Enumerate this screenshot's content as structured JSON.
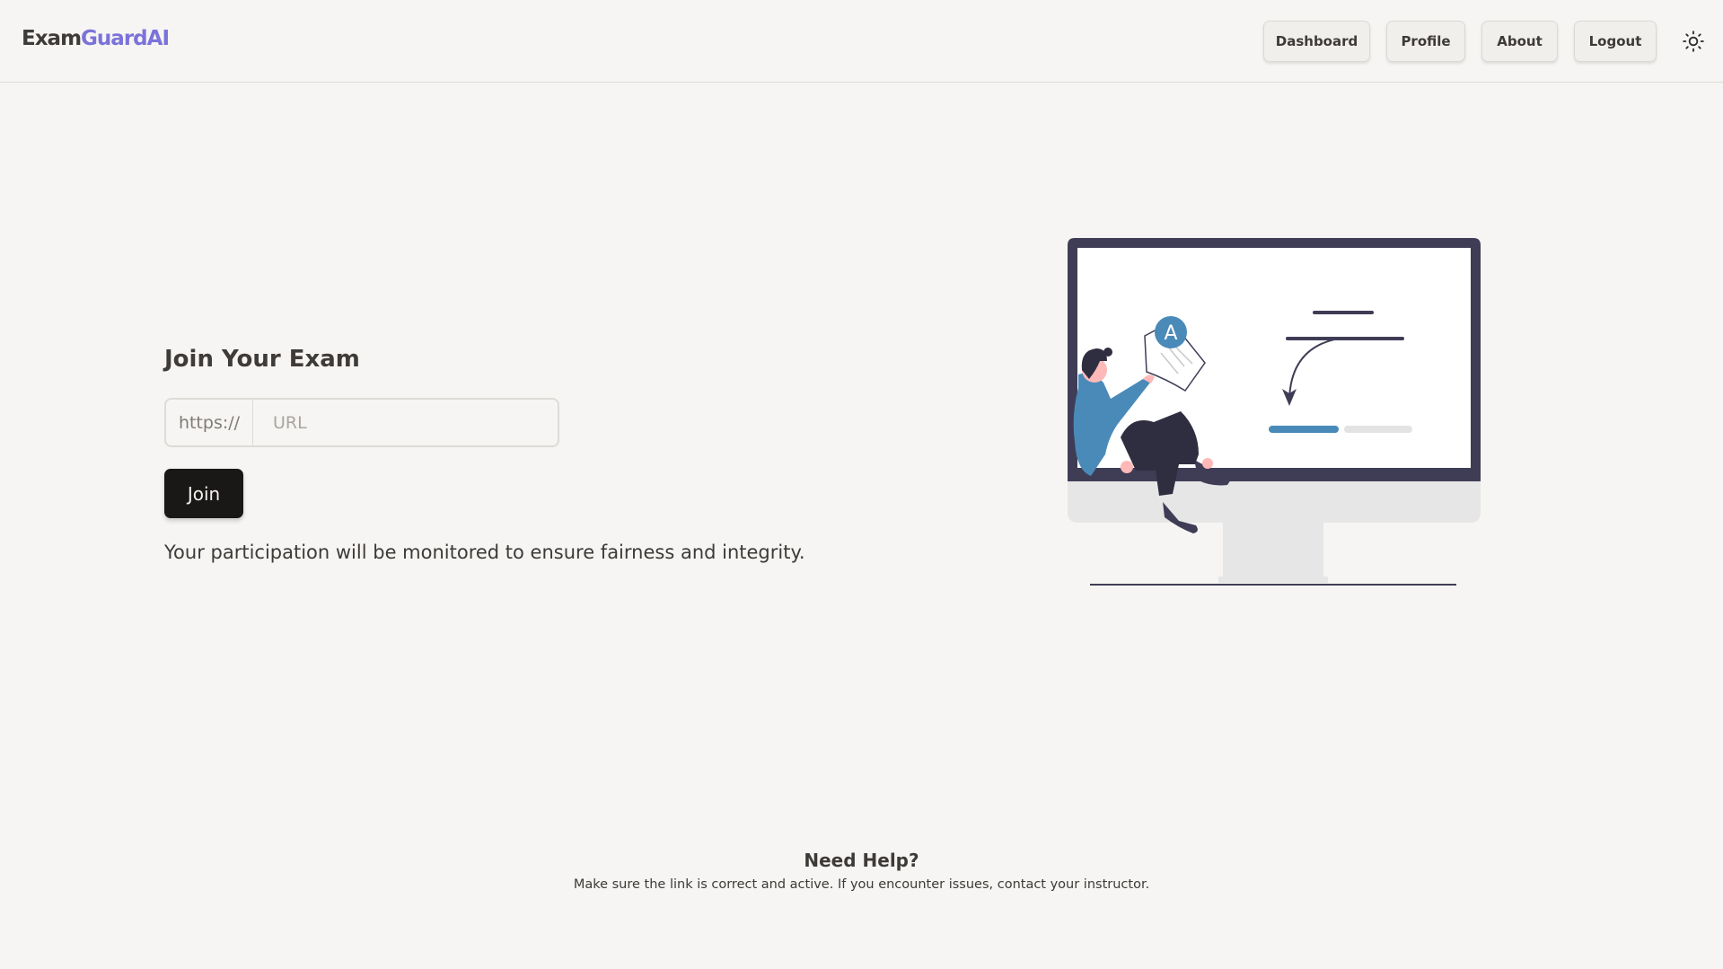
{
  "app": {
    "logo_part1": "Exam",
    "logo_part2": "Guard",
    "logo_part3": "AI"
  },
  "nav": {
    "dashboard": "Dashboard",
    "profile": "Profile",
    "about": "About",
    "logout": "Logout",
    "theme_icon": "sun-icon"
  },
  "join": {
    "title": "Join Your Exam",
    "url_prefix": "https://",
    "url_placeholder": "URL",
    "url_value": "",
    "button_label": "Join",
    "note": "Your participation will be monitored to ensure fairness and integrity."
  },
  "illustration": {
    "badge_letter": "A"
  },
  "help": {
    "title": "Need Help?",
    "text": "Make sure the link is correct and active. If you encounter issues, contact your instructor."
  },
  "colors": {
    "background": "#f6f5f3",
    "logo_accent": "#7b73d9",
    "primary_button": "#1a1817",
    "illustration_blue": "#4a8ab9",
    "illustration_dark": "#3f3d56"
  }
}
